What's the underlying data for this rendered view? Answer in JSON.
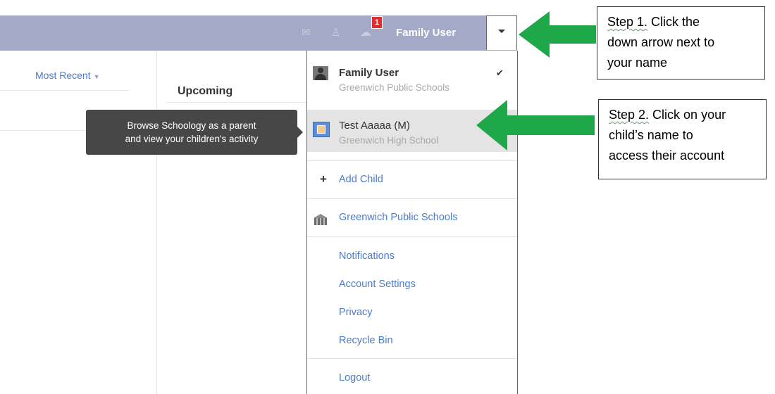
{
  "header": {
    "user_name": "Family User",
    "notification_count": "1",
    "icons": [
      "mail-icon",
      "people-icon",
      "bell-icon",
      "chevron-down-icon"
    ]
  },
  "feed": {
    "sort_label": "Most Recent",
    "upcoming_heading": "Upcoming"
  },
  "tooltip": {
    "line1": "Browse Schoology as a parent",
    "line2": "and view your children's activity"
  },
  "dropdown": {
    "current_user": {
      "name": "Family User",
      "school": "Greenwich Public Schools"
    },
    "child": {
      "name": "Test Aaaaa (M)",
      "school": "Greenwich High School"
    },
    "add_child": "Add Child",
    "school_link": "Greenwich Public Schools",
    "menu_links": [
      "Notifications",
      "Account Settings",
      "Privacy",
      "Recycle Bin"
    ],
    "logout": "Logout"
  },
  "callouts": {
    "step1": {
      "step_label": "Step 1.",
      "line1_rest": " Click the",
      "line2": "down arrow next to",
      "line3": "your name"
    },
    "step2": {
      "step_label": "Step 2.",
      "line1_rest": " Click on your",
      "line2": "child’s name to",
      "line3": "access their account"
    }
  },
  "colors": {
    "topbar": "#a3a9c6",
    "link": "#4a7cc9",
    "arrow_green": "#1fa84a",
    "badge_red": "#e12d2d"
  }
}
